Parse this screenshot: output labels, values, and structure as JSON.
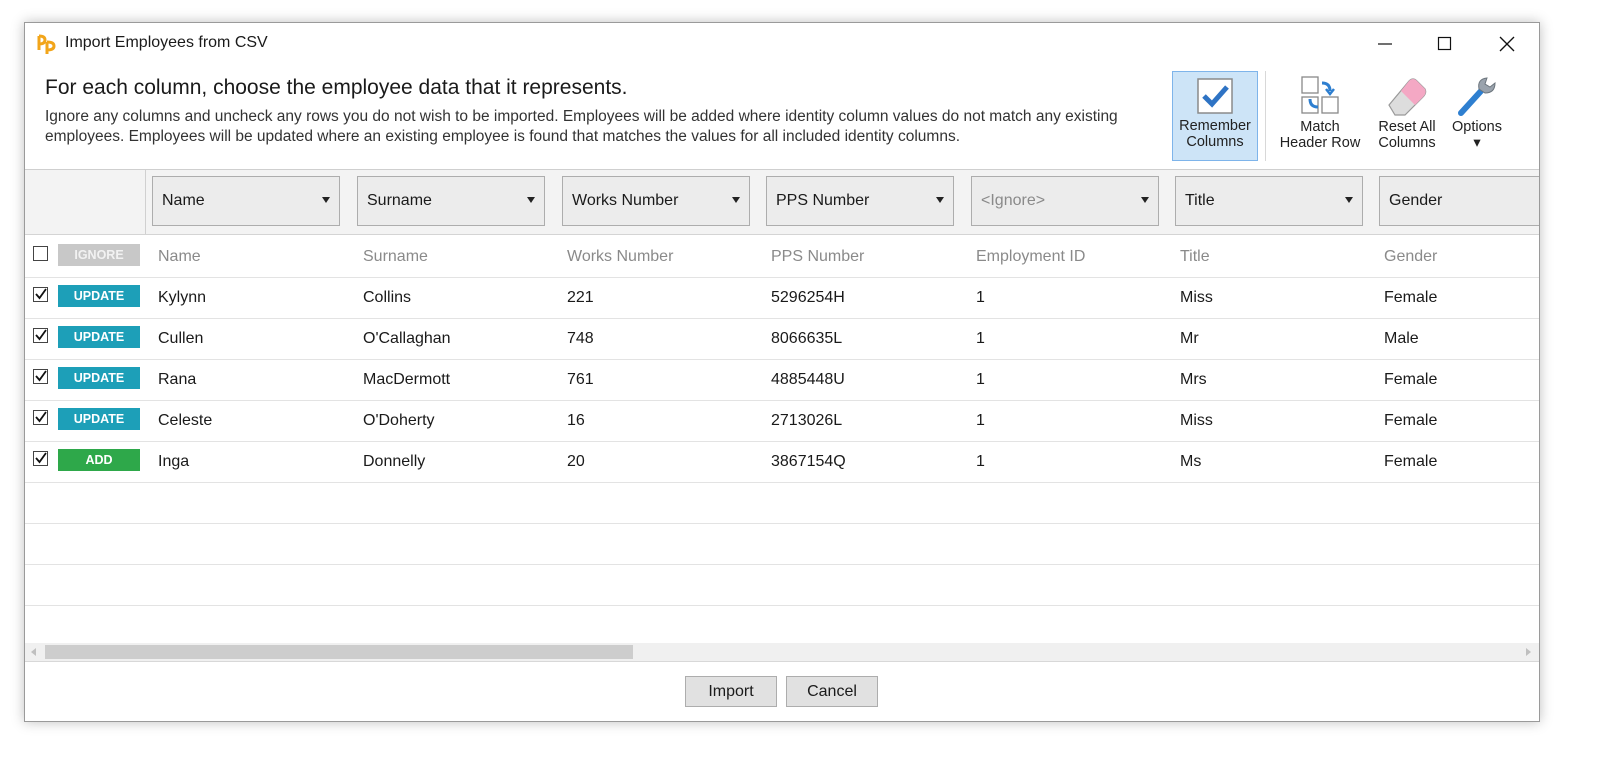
{
  "window": {
    "title": "Import Employees from CSV"
  },
  "instructions": {
    "heading": "For each column, choose the employee data that it represents.",
    "body": "Ignore any columns and uncheck any rows you do not wish to be imported. Employees will be added where identity column values do not match any existing employees. Employees will be updated where an existing employee is found that matches the values for all included identity columns."
  },
  "toolbar": {
    "remember": {
      "line1": "Remember",
      "line2": "Columns",
      "active": true
    },
    "match": {
      "line1": "Match",
      "line2": "Header Row"
    },
    "reset": {
      "line1": "Reset All",
      "line2": "Columns"
    },
    "options": {
      "line1": "Options",
      "arrow": "▾"
    }
  },
  "column_mappings": [
    "Name",
    "Surname",
    "Works Number",
    "PPS Number",
    "<Ignore>",
    "Title",
    "Gender"
  ],
  "header_row": {
    "checked": false,
    "status": "IGNORE",
    "cells": [
      "Name",
      "Surname",
      "Works Number",
      "PPS Number",
      "Employment ID",
      "Title",
      "Gender"
    ]
  },
  "rows": [
    {
      "checked": true,
      "status": "UPDATE",
      "cells": [
        "Kylynn",
        "Collins",
        "221",
        "5296254H",
        "1",
        "Miss",
        "Female"
      ]
    },
    {
      "checked": true,
      "status": "UPDATE",
      "cells": [
        "Cullen",
        "O'Callaghan",
        "748",
        "8066635L",
        "1",
        "Mr",
        "Male"
      ]
    },
    {
      "checked": true,
      "status": "UPDATE",
      "cells": [
        "Rana",
        "MacDermott",
        "761",
        "4885448U",
        "1",
        "Mrs",
        "Female"
      ]
    },
    {
      "checked": true,
      "status": "UPDATE",
      "cells": [
        "Celeste",
        "O'Doherty",
        "16",
        "2713026L",
        "1",
        "Miss",
        "Female"
      ]
    },
    {
      "checked": true,
      "status": "ADD",
      "cells": [
        "Inga",
        "Donnelly",
        "20",
        "3867154Q",
        "1",
        "Ms",
        "Female"
      ]
    }
  ],
  "footer": {
    "import_label": "Import",
    "cancel_label": "Cancel"
  },
  "colors": {
    "update": "#1d9fb8",
    "add": "#2ea84a",
    "ignore": "#c8c8c8",
    "accent": "#7eb4ea"
  }
}
